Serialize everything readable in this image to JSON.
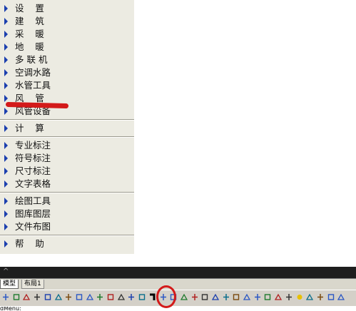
{
  "menu": {
    "items": [
      {
        "label": "设    置"
      },
      {
        "label": "建    筑"
      },
      {
        "label": "采    暖"
      },
      {
        "label": "地    暖"
      },
      {
        "label": "多 联 机"
      },
      {
        "label": "空调水路"
      },
      {
        "label": "水管工具"
      },
      {
        "label": "风    管"
      },
      {
        "label": "风管设备"
      },
      {
        "label": "计    算"
      },
      {
        "label": "专业标注"
      },
      {
        "label": "符号标注"
      },
      {
        "label": "尺寸标注"
      },
      {
        "label": "文字表格"
      },
      {
        "label": "绘图工具"
      },
      {
        "label": "图库图层"
      },
      {
        "label": "文件布图"
      },
      {
        "label": "帮    助"
      }
    ]
  },
  "tabs": {
    "model": "模型",
    "layout1": "布局1"
  },
  "toolbar": {
    "icons": [
      "open-icon",
      "find-icon",
      "save-icon",
      "markup-icon",
      "pipe-icon",
      "elbow-icon",
      "tee-icon",
      "valve-icon",
      "duct-icon",
      "bend-icon",
      "flange-icon",
      "reducer-icon",
      "cap-icon",
      "branch-icon",
      "duct-elbow-icon",
      "damper-icon",
      "outlet-icon",
      "fan-icon",
      "diffuser-icon",
      "grille-icon",
      "silencer-icon",
      "hood-icon",
      "coil-icon",
      "filter-icon",
      "heater-icon",
      "box-icon",
      "vent-icon",
      "louver-icon",
      "sun-icon",
      "table-icon",
      "layer-icon",
      "edit-icon",
      "rotate-icon"
    ]
  },
  "command_line": {
    "text": "dMenu:"
  },
  "colors": {
    "menu_bg": "#ecebe2",
    "arrow": "#1b3fae",
    "annotation_red": "#d31a1a",
    "toolbar_bg": "#d4d0c8"
  }
}
